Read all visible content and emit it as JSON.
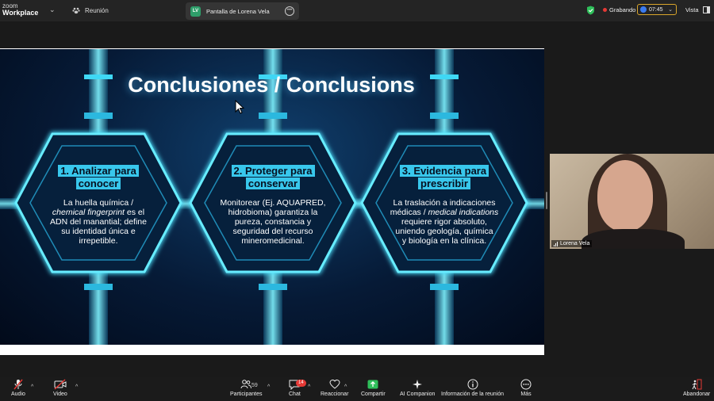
{
  "topbar": {
    "brand_top": "zoom",
    "brand_bottom": "Workplace",
    "meeting_label": "Reunión",
    "share_badge": "LV",
    "share_label": "Pantalla de Lorena Vela",
    "recording_label": "Grabando",
    "timer": "07:45",
    "view_label": "Vista"
  },
  "slide": {
    "title": "Conclusiones / Conclusions",
    "cards": [
      {
        "title_lines": [
          "1. Analizar para",
          "conocer"
        ],
        "body": [
          "La huella química /",
          "chemical fingerprint",
          " es el",
          "ADN del manantial; define",
          "su identidad única e",
          "irrepetible."
        ]
      },
      {
        "title_lines": [
          "2. Proteger para",
          "conservar"
        ],
        "body": [
          "Monitorear (Ej. AQUAPRED,",
          "hidrobioma) garantiza la",
          "pureza, constancia y",
          "seguridad del recurso",
          "mineromedicinal."
        ]
      },
      {
        "title_lines": [
          "3. Evidencia para",
          "prescribir"
        ],
        "body": [
          "La traslación a indicaciones",
          "médicas / ",
          "medical indications",
          "requiere rigor absoluto,",
          "uniendo geología, química",
          "y biología en la clínica."
        ]
      }
    ]
  },
  "participant": {
    "name": "Lorena Vela"
  },
  "toolbar": {
    "audio": "Audio",
    "video": "Video",
    "participants": "Participantes",
    "participants_count": "59",
    "chat": "Chat",
    "chat_badge": "14",
    "react": "Reaccionar",
    "share": "Compartir",
    "ai": "AI Companion",
    "info": "Información de la reunión",
    "more": "Más",
    "leave": "Abandonar"
  },
  "colors": {
    "accent_cyan": "#38c7ec",
    "record_red": "#e53935",
    "share_green": "#2e9e6a"
  }
}
